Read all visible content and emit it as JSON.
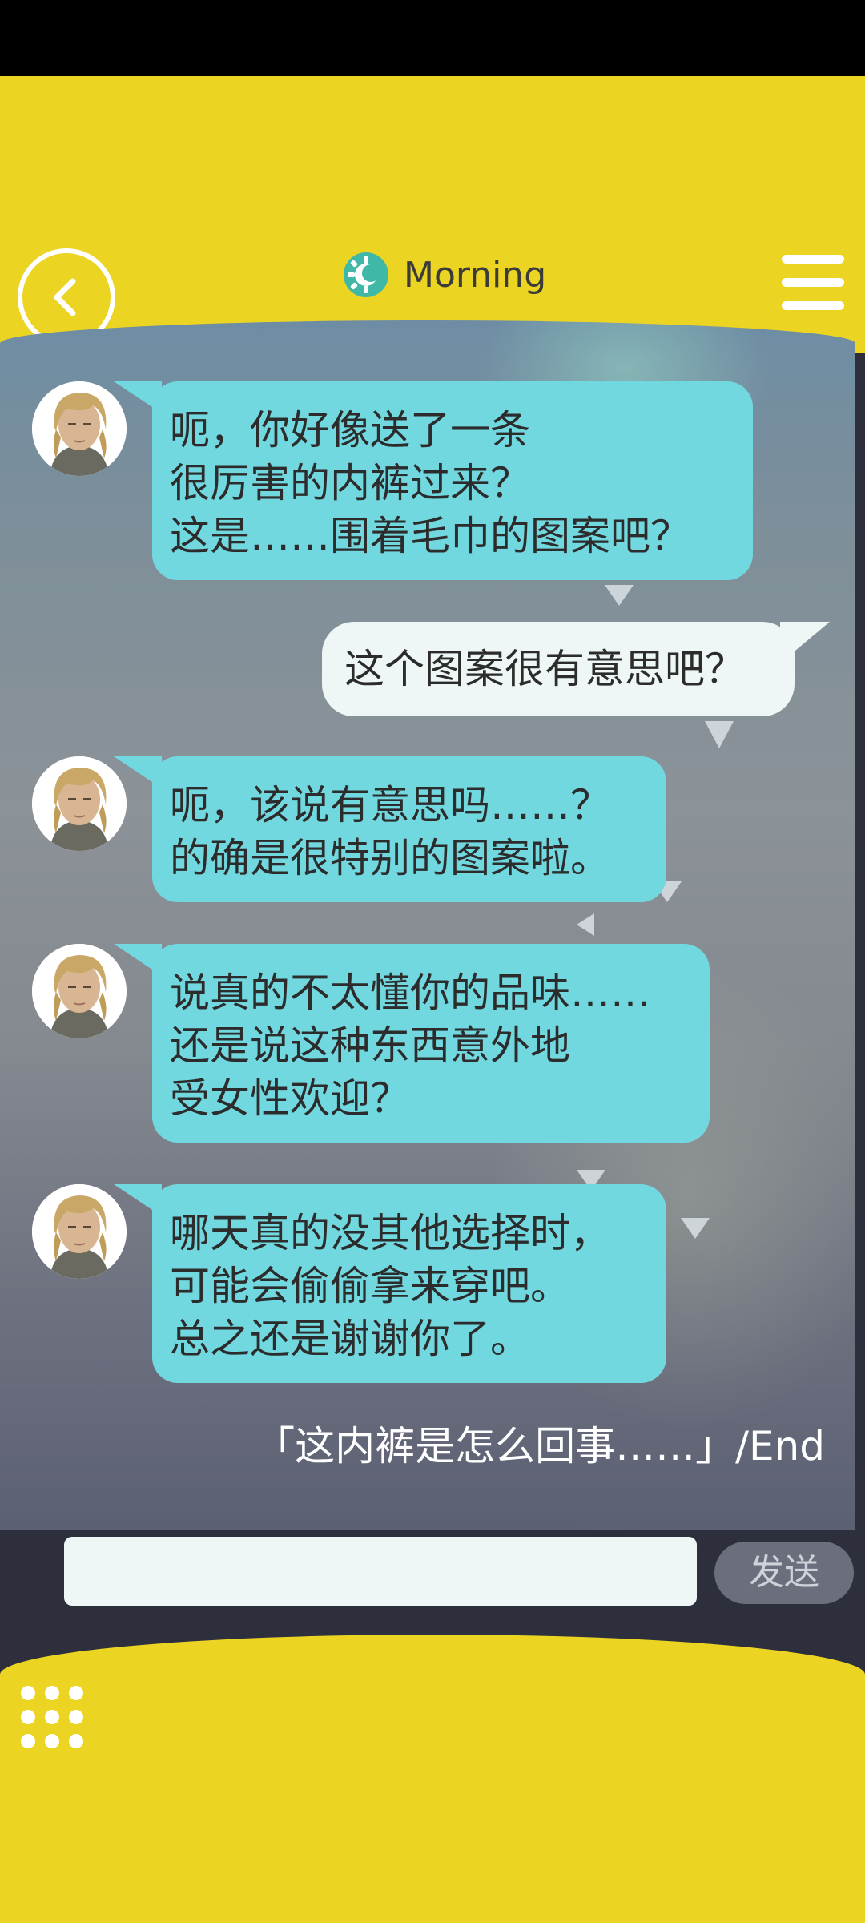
{
  "header": {
    "title": "Morning",
    "time_icon": "sun-gear-icon",
    "back_icon": "chevron-left-icon",
    "menu_icon": "hamburger-menu-icon"
  },
  "colors": {
    "accent_yellow": "#ebd422",
    "npc_bubble": "#72d8e0",
    "user_bubble": "#eef6f6",
    "input_bar": "#2d2f3d"
  },
  "messages": [
    {
      "sender": "npc",
      "text": "呃，你好像送了一条\n很厉害的内裤过来？\n这是……围着毛巾的图案吧？"
    },
    {
      "sender": "user",
      "text": "这个图案很有意思吧？"
    },
    {
      "sender": "npc",
      "text": "呃，该说有意思吗……？\n的确是很特别的图案啦。"
    },
    {
      "sender": "npc",
      "text": "说真的不太懂你的品味……\n还是说这种东西意外地\n受女性欢迎？"
    },
    {
      "sender": "npc",
      "text": "哪天真的没其他选择时，\n可能会偷偷拿来穿吧。\n总之还是谢谢你了。"
    }
  ],
  "end_text": "「这内裤是怎么回事……」/End",
  "input": {
    "value": "",
    "placeholder": ""
  },
  "send_label": "发送",
  "bottom_icon": "grid-dots-icon"
}
